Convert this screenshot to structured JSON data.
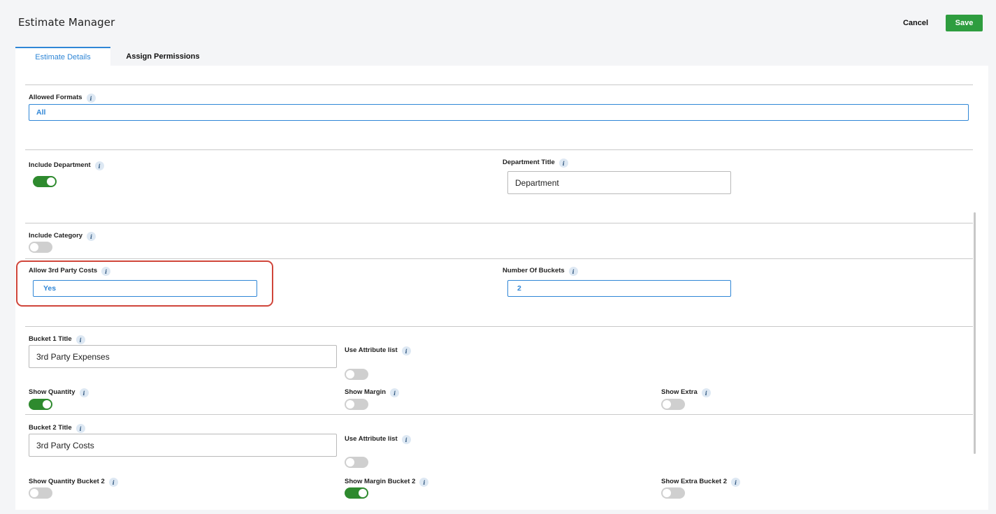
{
  "header": {
    "title": "Estimate Manager",
    "cancel_label": "Cancel",
    "save_label": "Save"
  },
  "tabs": [
    {
      "label": "Estimate Details",
      "active": true
    },
    {
      "label": "Assign Permissions",
      "active": false
    }
  ],
  "info_glyph": "i",
  "form": {
    "allowed_formats": {
      "label": "Allowed Formats",
      "value": "All"
    },
    "include_department": {
      "label": "Include Department",
      "on": true
    },
    "department_title": {
      "label": "Department Title",
      "value": "Department"
    },
    "include_category": {
      "label": "Include Category",
      "on": false
    },
    "allow_3rd_party_costs": {
      "label": "Allow 3rd Party Costs",
      "value": "Yes"
    },
    "number_of_buckets": {
      "label": "Number Of Buckets",
      "value": "2"
    },
    "bucket1": {
      "title_label": "Bucket 1 Title",
      "title_value": "3rd Party Expenses",
      "use_attribute_list": {
        "label": "Use Attribute list",
        "on": false
      },
      "show_quantity": {
        "label": "Show Quantity",
        "on": true
      },
      "show_margin": {
        "label": "Show Margin",
        "on": false
      },
      "show_extra": {
        "label": "Show Extra",
        "on": false
      }
    },
    "bucket2": {
      "title_label": "Bucket 2 Title",
      "title_value": "3rd Party Costs",
      "use_attribute_list": {
        "label": "Use Attribute list",
        "on": false
      },
      "show_quantity": {
        "label": "Show Quantity Bucket 2",
        "on": false
      },
      "show_margin": {
        "label": "Show Margin Bucket 2",
        "on": true
      },
      "show_extra": {
        "label": "Show Extra Bucket 2",
        "on": false
      }
    }
  },
  "colors": {
    "accent": "#2f86d6",
    "save": "#2e9d3f",
    "toggle_on": "#2e8a2e",
    "highlight": "#d0453a"
  }
}
